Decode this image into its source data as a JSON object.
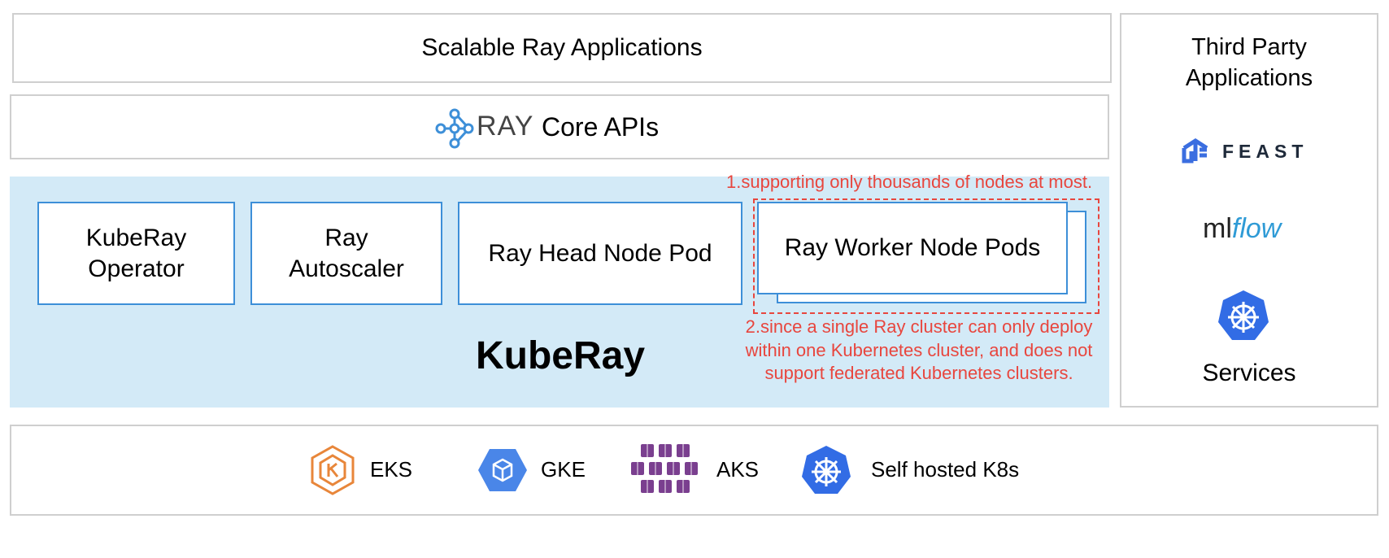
{
  "layers": {
    "applications": "Scalable Ray Applications",
    "core_apis": {
      "logo_text": "RAY",
      "label": "Core APIs"
    },
    "kuberay": {
      "title": "KubeRay",
      "components": [
        "KubeRay\nOperator",
        "Ray\nAutoscaler",
        "Ray Head Node Pod",
        "Ray Worker Node Pods"
      ]
    }
  },
  "annotations": {
    "note1": "1.supporting only thousands of nodes at most.",
    "note2_lines": [
      "2.since a single Ray cluster can only deploy",
      "within one Kubernetes cluster, and does not",
      "support federated Kubernetes clusters."
    ]
  },
  "third_party": {
    "title": "Third Party\nApplications",
    "feast": "FEAST",
    "mlflow_ml": "ml",
    "mlflow_flow": "flow",
    "services": "Services"
  },
  "platforms": [
    {
      "icon": "eks-icon",
      "label": "EKS"
    },
    {
      "icon": "gke-icon",
      "label": "GKE"
    },
    {
      "icon": "aks-icon",
      "label": "AKS"
    },
    {
      "icon": "kubernetes-icon",
      "label": "Self hosted K8s"
    }
  ],
  "colors": {
    "kuberay_bg": "#d3eaf7",
    "component_border": "#3d8fd8",
    "annotation_red": "#e8463e",
    "eks_orange": "#e8863a",
    "gke_blue": "#4a86e8",
    "aks_purple": "#7a3f8f",
    "k8s_blue": "#326ce5"
  }
}
